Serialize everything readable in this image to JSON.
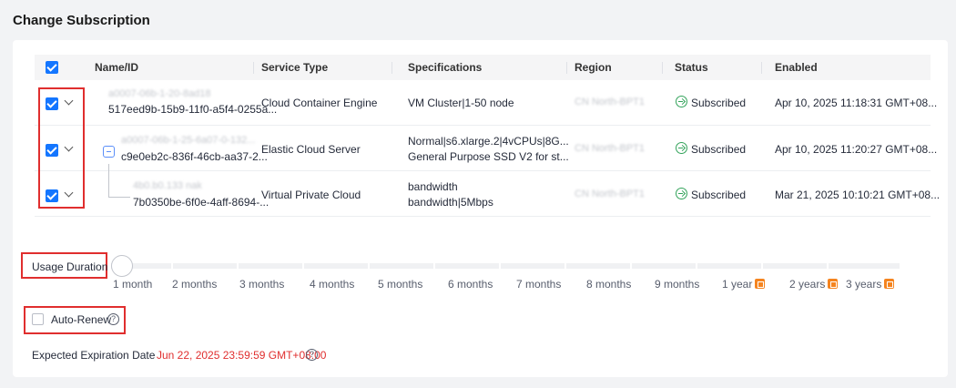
{
  "page_title": "Change Subscription",
  "table": {
    "headers": {
      "name": "Name/ID",
      "service_type": "Service Type",
      "specifications": "Specifications",
      "region": "Region",
      "status": "Status",
      "enabled": "Enabled"
    },
    "rows": [
      {
        "name": "a0007-06b-1-20-8ad18",
        "id": "517eed9b-15b9-11f0-a5f4-0255a...",
        "service_type": "Cloud Container Engine",
        "spec_line1": "VM Cluster|1-50 node",
        "spec_line2": "",
        "region": "CN North-BPT1",
        "status": "Subscribed",
        "enabled": "Apr 10, 2025 11:18:31 GMT+08..."
      },
      {
        "name": "a0007-06b-1-25-6a07-0-132...",
        "id": "c9e0eb2c-836f-46cb-aa37-2...",
        "service_type": "Elastic Cloud Server",
        "spec_line1": "Normal|s6.xlarge.2|4vCPUs|8G...",
        "spec_line2": "General Purpose SSD V2 for st...",
        "region": "CN North-BPT1",
        "status": "Subscribed",
        "enabled": "Apr 10, 2025 11:20:27 GMT+08..."
      },
      {
        "name": "4b0.b0.133 nak",
        "id": "7b0350be-6f0e-4aff-8694-...",
        "service_type": "Virtual Private Cloud",
        "spec_line1": "bandwidth",
        "spec_line2": "bandwidth|5Mbps",
        "region": "CN North-BPT1",
        "status": "Subscribed",
        "enabled": "Mar 21, 2025 10:10:21 GMT+08..."
      }
    ]
  },
  "usage_duration": {
    "label": "Usage Duration",
    "options": [
      "1 month",
      "2 months",
      "3 months",
      "4 months",
      "5 months",
      "6 months",
      "7 months",
      "8 months",
      "9 months",
      "1 year",
      "2 years",
      "3 years"
    ],
    "selected": "1 month",
    "discount_icon": "discount-icon"
  },
  "auto_renew": {
    "label": "Auto-Renew",
    "checked": false
  },
  "expiration": {
    "label": "Expected Expiration Date",
    "value": "Jun 22, 2025 23:59:59 GMT+08:00",
    "value_color": "#e02e2e"
  },
  "colors": {
    "accent": "#1476ff",
    "status_green": "#33a35b",
    "highlight_red": "#e02e2e",
    "discount_orange": "#f5841f"
  }
}
